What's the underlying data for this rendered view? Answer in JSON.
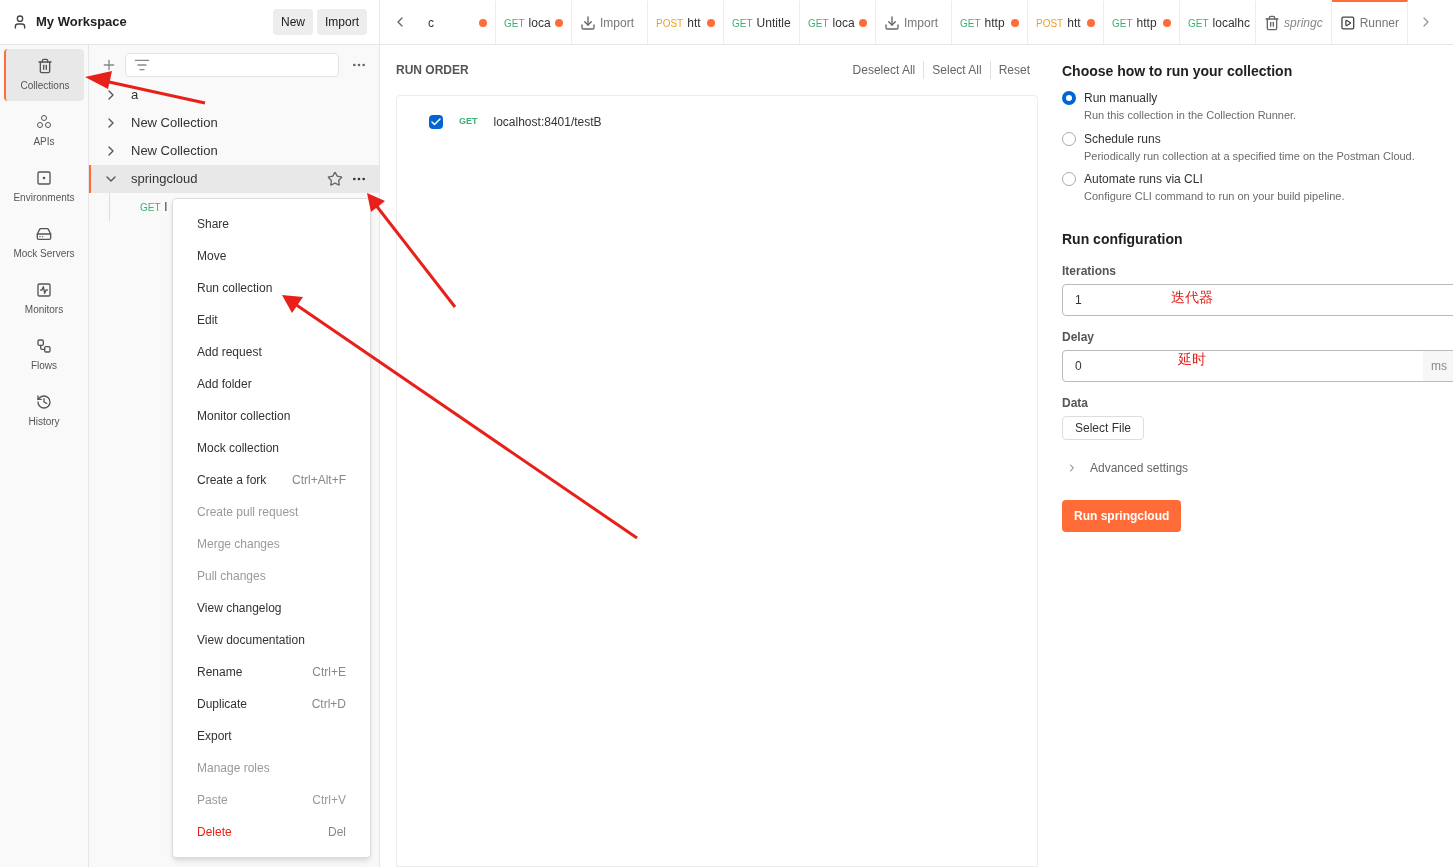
{
  "workspace": {
    "title": "My Workspace",
    "buttons": [
      "New",
      "Import"
    ]
  },
  "tabs": [
    {
      "kind": "request",
      "label": "c",
      "unsaved": true,
      "selected": false
    },
    {
      "kind": "request",
      "method": "GET",
      "label": "loca",
      "unsaved": true,
      "selected": false
    },
    {
      "kind": "import",
      "label": "Import",
      "unsaved": false,
      "selected": false
    },
    {
      "kind": "request",
      "method": "POST",
      "label": "htt",
      "unsaved": true,
      "selected": false
    },
    {
      "kind": "request",
      "method": "GET",
      "label": "Untitle",
      "unsaved": false,
      "selected": false
    },
    {
      "kind": "request",
      "method": "GET",
      "label": "loca",
      "unsaved": true,
      "selected": false
    },
    {
      "kind": "import",
      "label": "Import",
      "unsaved": false,
      "selected": false
    },
    {
      "kind": "request",
      "method": "GET",
      "label": "http",
      "unsaved": true,
      "selected": false
    },
    {
      "kind": "request",
      "method": "POST",
      "label": "htt",
      "unsaved": true,
      "selected": false
    },
    {
      "kind": "request",
      "method": "GET",
      "label": "http",
      "unsaved": true,
      "selected": false
    },
    {
      "kind": "request",
      "method": "GET",
      "label": "localhc",
      "unsaved": false,
      "selected": false
    },
    {
      "kind": "collection",
      "label": "springc",
      "unsaved": false,
      "selected": false
    },
    {
      "kind": "runner",
      "label": "Runner",
      "unsaved": false,
      "selected": true
    }
  ],
  "nav": [
    {
      "kind": "collections",
      "label": "Collections",
      "selected": true
    },
    {
      "kind": "apis",
      "label": "APIs",
      "selected": false
    },
    {
      "kind": "environments",
      "label": "Environments",
      "selected": false
    },
    {
      "kind": "mock",
      "label": "Mock Servers",
      "selected": false
    },
    {
      "kind": "monitors",
      "label": "Monitors",
      "selected": false
    },
    {
      "kind": "flows",
      "label": "Flows",
      "selected": false
    },
    {
      "kind": "history",
      "label": "History",
      "selected": false
    }
  ],
  "tree": [
    {
      "label": "a",
      "expanded": false,
      "selected": false
    },
    {
      "label": "New Collection",
      "expanded": false,
      "selected": false
    },
    {
      "label": "New Collection",
      "expanded": false,
      "selected": false
    },
    {
      "label": "springcloud",
      "expanded": true,
      "selected": true,
      "children": [
        {
          "method": "GET",
          "label": "l"
        }
      ]
    }
  ],
  "context_menu": [
    {
      "label": "Share",
      "disabled": false,
      "danger": false
    },
    {
      "label": "Move",
      "disabled": false,
      "danger": false
    },
    {
      "label": "Run collection",
      "disabled": false,
      "danger": false
    },
    {
      "label": "Edit",
      "disabled": false,
      "danger": false
    },
    {
      "label": "Add request",
      "disabled": false,
      "danger": false
    },
    {
      "label": "Add folder",
      "disabled": false,
      "danger": false
    },
    {
      "label": "Monitor collection",
      "disabled": false,
      "danger": false
    },
    {
      "label": "Mock collection",
      "disabled": false,
      "danger": false
    },
    {
      "label": "Create a fork",
      "shortcut": "Ctrl+Alt+F",
      "disabled": false,
      "danger": false
    },
    {
      "label": "Create pull request",
      "disabled": true,
      "danger": false
    },
    {
      "label": "Merge changes",
      "disabled": true,
      "danger": false
    },
    {
      "label": "Pull changes",
      "disabled": true,
      "danger": false
    },
    {
      "label": "View changelog",
      "disabled": false,
      "danger": false
    },
    {
      "label": "View documentation",
      "disabled": false,
      "danger": false
    },
    {
      "label": "Rename",
      "shortcut": "Ctrl+E",
      "disabled": false,
      "danger": false
    },
    {
      "label": "Duplicate",
      "shortcut": "Ctrl+D",
      "disabled": false,
      "danger": false
    },
    {
      "label": "Export",
      "disabled": false,
      "danger": false
    },
    {
      "label": "Manage roles",
      "disabled": true,
      "danger": false
    },
    {
      "label": "Paste",
      "shortcut": "Ctrl+V",
      "disabled": true,
      "danger": false
    },
    {
      "label": "Delete",
      "shortcut": "Del",
      "disabled": false,
      "danger": true
    }
  ],
  "run_order": {
    "title": "RUN ORDER",
    "actions": [
      "Deselect All",
      "Select All",
      "Reset"
    ],
    "requests": [
      {
        "checked": true,
        "method": "GET",
        "url": "localhost:8401/testB"
      }
    ]
  },
  "config": {
    "title": "Choose how to run your collection",
    "options": [
      {
        "title": "Run manually",
        "description": "Run this collection in the Collection Runner.",
        "selected": true
      },
      {
        "title": "Schedule runs",
        "description": "Periodically run collection at a specified time on the Postman Cloud.",
        "selected": false
      },
      {
        "title": "Automate runs via CLI",
        "description": "Configure CLI command to run on your build pipeline.",
        "selected": false
      }
    ],
    "section_title": "Run configuration",
    "iterations": {
      "label": "Iterations",
      "value": "1",
      "annotation": "迭代器"
    },
    "delay": {
      "label": "Delay",
      "value": "0",
      "unit": "ms",
      "annotation": "延时"
    },
    "data": {
      "label": "Data",
      "button": "Select File"
    },
    "advanced": {
      "label": "Advanced settings",
      "expanded": false
    },
    "run_button": "Run springcloud"
  }
}
